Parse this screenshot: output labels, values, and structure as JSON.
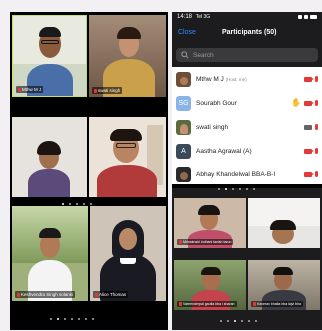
{
  "left_screen": {
    "gallery_top": [
      {
        "name": "Mthw M J"
      },
      {
        "name": "swati singh"
      },
      {
        "name": ""
      },
      {
        "name": ""
      }
    ],
    "gallery_bottom": [
      {
        "name": "Keshvendra Singh solanki"
      },
      {
        "name": "Alice Thomas"
      }
    ]
  },
  "right_screen": {
    "status_bar": {
      "time": "14:18",
      "network": "Tel 3G"
    },
    "header": {
      "close_label": "Close",
      "title": "Participants (50)"
    },
    "search": {
      "placeholder": "Search"
    },
    "participants": [
      {
        "name": "Mthw M J",
        "tag": "(Host, me)",
        "avatar_initials": "",
        "avatar_color": "#6b4f3a",
        "raised_hand": false,
        "video_off": true,
        "muted": true
      },
      {
        "name": "Sourabh Gour",
        "tag": "",
        "avatar_initials": "SG",
        "avatar_color": "#8ab4e8",
        "raised_hand": true,
        "video_off": true,
        "muted": true
      },
      {
        "name": "swati singh",
        "tag": "",
        "avatar_initials": "",
        "avatar_color": "#5b6b3f",
        "raised_hand": false,
        "video_off": false,
        "muted": true
      },
      {
        "name": "Aastha Agrawal (A)",
        "tag": "",
        "avatar_initials": "A",
        "avatar_color": "#3b4a5a",
        "raised_hand": false,
        "video_off": true,
        "muted": true
      },
      {
        "name": "Abhay Khandelwal BBA-B-I",
        "tag": "",
        "avatar_initials": "",
        "avatar_color": "#2a2a2a",
        "raised_hand": false,
        "video_off": true,
        "muted": true
      }
    ],
    "gallery": [
      {
        "name": "Mrinaknshi lodhani tanish tarun"
      },
      {
        "name": ""
      },
      {
        "name": "Vareenderpal gautla bba i sharan"
      },
      {
        "name": "Kaverav bhatia bba lajvi bha"
      }
    ]
  },
  "colors": {
    "accent": "#2d8cff",
    "danger": "#e53935",
    "active_speaker": "#c6e05a"
  }
}
